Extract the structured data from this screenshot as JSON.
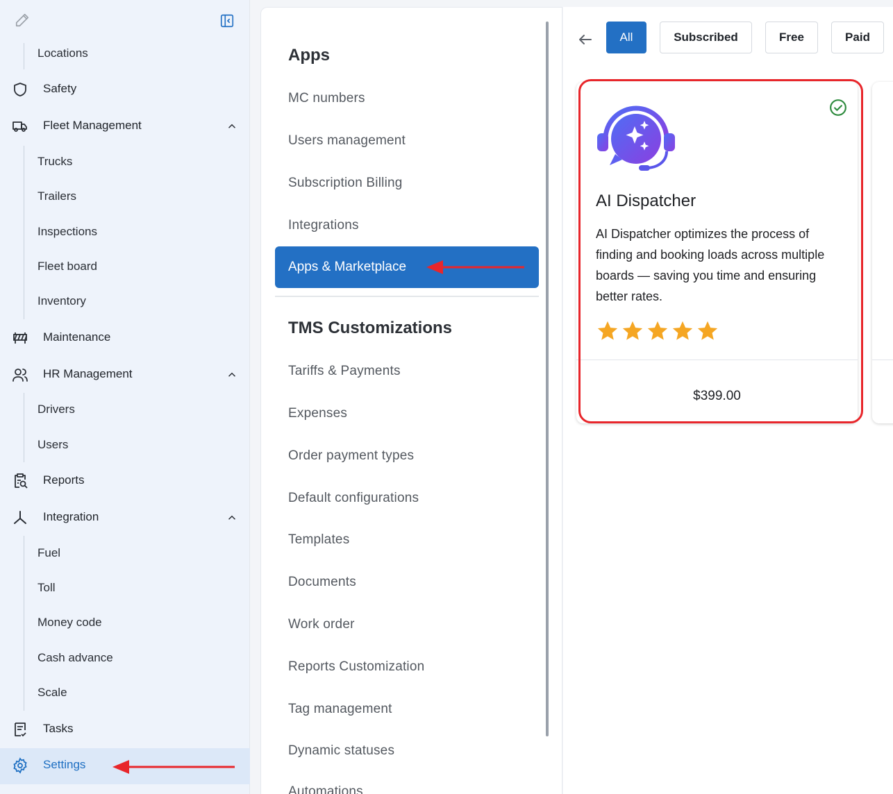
{
  "sidebar": {
    "items": [
      {
        "label": "Locations",
        "kind": "sub"
      },
      {
        "label": "Safety",
        "icon": "shield-icon"
      },
      {
        "label": "Fleet Management",
        "icon": "truck-icon",
        "expanded": true
      },
      {
        "label": "Trucks",
        "kind": "sub"
      },
      {
        "label": "Trailers",
        "kind": "sub"
      },
      {
        "label": "Inspections",
        "kind": "sub"
      },
      {
        "label": "Fleet board",
        "kind": "sub"
      },
      {
        "label": "Inventory",
        "kind": "sub"
      },
      {
        "label": "Maintenance",
        "icon": "maintenance-icon"
      },
      {
        "label": "HR Management",
        "icon": "people-icon",
        "expanded": true
      },
      {
        "label": "Drivers",
        "kind": "sub"
      },
      {
        "label": "Users",
        "kind": "sub"
      },
      {
        "label": "Reports",
        "icon": "report-icon"
      },
      {
        "label": "Integration",
        "icon": "integration-icon",
        "expanded": true
      },
      {
        "label": "Fuel",
        "kind": "sub"
      },
      {
        "label": "Toll",
        "kind": "sub"
      },
      {
        "label": "Money code",
        "kind": "sub"
      },
      {
        "label": "Cash advance",
        "kind": "sub"
      },
      {
        "label": "Scale",
        "kind": "sub"
      },
      {
        "label": "Tasks",
        "icon": "tasks-icon"
      },
      {
        "label": "Settings",
        "icon": "gear-icon",
        "active": true
      }
    ]
  },
  "settings_menu": {
    "apps_heading": "Apps",
    "apps_items": [
      "MC numbers",
      "Users management",
      "Subscription Billing",
      "Integrations"
    ],
    "active_item": "Apps & Marketplace",
    "tms_heading": "TMS Customizations",
    "tms_items": [
      "Tariffs & Payments",
      "Expenses",
      "Order payment types",
      "Default configurations",
      "Templates",
      "Documents",
      "Work order",
      "Reports Customization",
      "Tag management",
      "Dynamic statuses",
      "Automations"
    ]
  },
  "marketplace": {
    "filters": [
      "All",
      "Subscribed",
      "Free",
      "Paid"
    ],
    "active_filter": "All",
    "app_card": {
      "title": "AI Dispatcher",
      "description": "AI Dispatcher optimizes the process of finding and booking loads across multiple boards — saving you time and ensuring better rates.",
      "rating": 5,
      "price": "$399.00",
      "subscribed_icon": "check-circle-icon"
    }
  },
  "colors": {
    "accent": "#2370c4",
    "annotation": "#e8262b",
    "star": "#f5a623",
    "check": "#2e8b3e"
  }
}
